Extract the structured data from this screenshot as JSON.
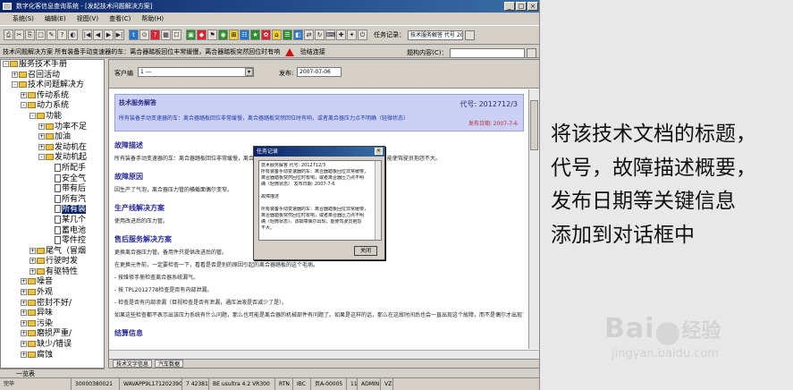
{
  "window": {
    "title": "数字化客信息查询系统 - [发起技术问题解决方案]",
    "controls": [
      "_",
      "□",
      "×"
    ]
  },
  "menu": [
    "系统(S)",
    "编辑(E)",
    "视图(V)",
    "查看(C)",
    "帮助(H)"
  ],
  "toolbar": {
    "glyphs": [
      "⎙",
      "✂",
      "⎘",
      "□",
      "✎",
      "?",
      "◐",
      "|◀",
      "◀",
      "▶",
      "▶|",
      "t",
      "⊙",
      "?",
      "▦",
      "☐",
      "▣",
      "◆",
      "⚑",
      "◉",
      "⊞",
      "☷",
      "★",
      "✿",
      "⌂",
      "☰",
      "◧",
      "⇄",
      "↻",
      "⌨",
      "✚",
      "✦",
      "⏻"
    ],
    "task_label": "任务记录：",
    "task_value": "技术服务解答 代号 20"
  },
  "subbar": {
    "left_text": "技术问题解决方案 所有装备手动变速器的车：离合器踏板回位丰常缓慢，离合器踏板突然回位时有响",
    "link_text": "验结连接",
    "right_label": "题构内容(C)："
  },
  "tree": [
    {
      "lvl": 0,
      "pm": "-",
      "icon": "fd",
      "text": "服务技术手册"
    },
    {
      "lvl": 1,
      "pm": "+",
      "icon": "fd",
      "text": "召回活动"
    },
    {
      "lvl": 1,
      "pm": "-",
      "icon": "fd",
      "text": "技术问题解决方"
    },
    {
      "lvl": 2,
      "pm": "+",
      "icon": "fd",
      "text": "传动系统"
    },
    {
      "lvl": 2,
      "pm": "-",
      "icon": "fd",
      "text": "动力系统"
    },
    {
      "lvl": 3,
      "pm": "-",
      "icon": "fd",
      "text": "功能"
    },
    {
      "lvl": 4,
      "pm": "+",
      "icon": "fd",
      "text": "功率不足"
    },
    {
      "lvl": 4,
      "pm": "+",
      "icon": "fd",
      "text": "加油"
    },
    {
      "lvl": 4,
      "pm": "+",
      "icon": "fd",
      "text": "发动机在"
    },
    {
      "lvl": 4,
      "pm": "-",
      "icon": "fd",
      "text": "发动机起"
    },
    {
      "lvl": 5,
      "pm": "",
      "icon": "doc",
      "text": "所配手"
    },
    {
      "lvl": 5,
      "pm": "",
      "icon": "doc",
      "text": "安全气"
    },
    {
      "lvl": 5,
      "pm": "",
      "icon": "doc",
      "text": "带有后"
    },
    {
      "lvl": 5,
      "pm": "",
      "icon": "doc",
      "text": "所有汽"
    },
    {
      "lvl": 5,
      "pm": "",
      "icon": "doc",
      "text": "所有装",
      "selected": true
    },
    {
      "lvl": 5,
      "pm": "",
      "icon": "doc",
      "text": "某几个"
    },
    {
      "lvl": 5,
      "pm": "",
      "icon": "doc",
      "text": "蓄电池"
    },
    {
      "lvl": 5,
      "pm": "",
      "icon": "doc",
      "text": "零件控"
    },
    {
      "lvl": 3,
      "pm": "+",
      "icon": "fd",
      "text": "尾气（冒烟"
    },
    {
      "lvl": 3,
      "pm": "+",
      "icon": "fd",
      "text": "行驶时发"
    },
    {
      "lvl": 3,
      "pm": "+",
      "icon": "fd",
      "text": "有驱特性"
    },
    {
      "lvl": 2,
      "pm": "+",
      "icon": "fd",
      "text": "噪音"
    },
    {
      "lvl": 2,
      "pm": "+",
      "icon": "fd",
      "text": "外观"
    },
    {
      "lvl": 2,
      "pm": "+",
      "icon": "fd",
      "text": "密封不好/"
    },
    {
      "lvl": 2,
      "pm": "+",
      "icon": "fd",
      "text": "异味"
    },
    {
      "lvl": 2,
      "pm": "+",
      "icon": "fd",
      "text": "污染"
    },
    {
      "lvl": 2,
      "pm": "+",
      "icon": "fd",
      "text": "磨损严重/"
    },
    {
      "lvl": 2,
      "pm": "+",
      "icon": "fd",
      "text": "缺少/错误"
    },
    {
      "lvl": 2,
      "pm": "+",
      "icon": "fd",
      "text": "腐蚀"
    }
  ],
  "tree_tab": "一览表",
  "topbar": {
    "customer_label": "客户编",
    "customer_value": "1 ---",
    "date_label": "发布:",
    "date_value": "2007-07-06"
  },
  "doc": {
    "header_title": "技术服务解答",
    "header_code": "代号: 2012712/3",
    "header_desc": "所有装备手动变速器的车：离合器踏板回位非常缓慢，离合器踏板突然回位时有响，或者离合器压力点不明确（轻微状态）",
    "header_date": "发布日期: 2007-7-6",
    "sections": [
      {
        "title": "故障描述",
        "lines": [
          "所有装备手动变速器的车：离合器踏板回位非常缓慢，离合器踏板突然回位时有响                          （轻微状态）。该故障偶尔出现，能使驾驶员抱怨不大。"
        ]
      },
      {
        "title": "故障原因",
        "lines": [
          "因生产了气泡，离合器压力管的横截面偶尔变窄。"
        ]
      },
      {
        "title": "生产线解决方案",
        "lines": [
          "使用改进后的压力管。"
        ]
      },
      {
        "title": "售后服务解决方案",
        "lines": [
          "更换离合器压力管。备用件只提供改进后的管。",
          "在更换元件前，一定要检查一下，看看是否是别的原因引起的离合器踏板的这个毛病。",
          "- 按维修手册检查离合器系统漏气。",
          "- 按 TPL2012778检查是否有内部泄漏。",
          "- 检查是否有内部渗漏（目视检查是否有泄漏，通压油液是否减少了是）。",
          "如果这些检查都不表示出该压力系统有什么问题，那么也可能是离合器的机械部件有问题了。如果是这样的话，那么在这故时间后也会一直出现这个故障，而不是偶尔才出现了。"
        ]
      },
      {
        "title": "结算信息",
        "lines": []
      }
    ]
  },
  "bottom_tabs": [
    "技术文字信息",
    "汽车数据"
  ],
  "status": [
    "完毕",
    "30000380021",
    "WAVAPP9L1712023904",
    "7 423810",
    "BE usultra 4.2 VR300",
    "RTN",
    "IBC",
    "页A-00005",
    "11",
    "ADMIN",
    "VZ"
  ],
  "dialog": {
    "title": "任务记录",
    "lines": [
      "技术服务解答 代号: 2012712/3",
      "所有装备手动变速器的车：离合器踏板回位非常缓慢，",
      "离合器踏板突然回位时有响，或者离合器压力点不明",
      "确（轻微状态） 发布日期: 2007-7-6",
      "",
      "故障描述",
      "",
      "所有装备手动变速器的车：离合器踏板回位非常缓慢，",
      "离合器踏板突然回位时有响，或者离合器压力点不明",
      "确（轻微状态）。该故障偶尔出现，能使驾驶员抱怨",
      "不大。"
    ],
    "close_label": "关闭"
  },
  "annotation": [
    "将该技术文档的标题，",
    "代号，故障描述概要，",
    "发布日期等关键信息",
    "添加到对话框中"
  ],
  "watermark": {
    "logo_left": "Bai",
    "logo_right": "经验",
    "url": "jingyan.baidu.com"
  }
}
